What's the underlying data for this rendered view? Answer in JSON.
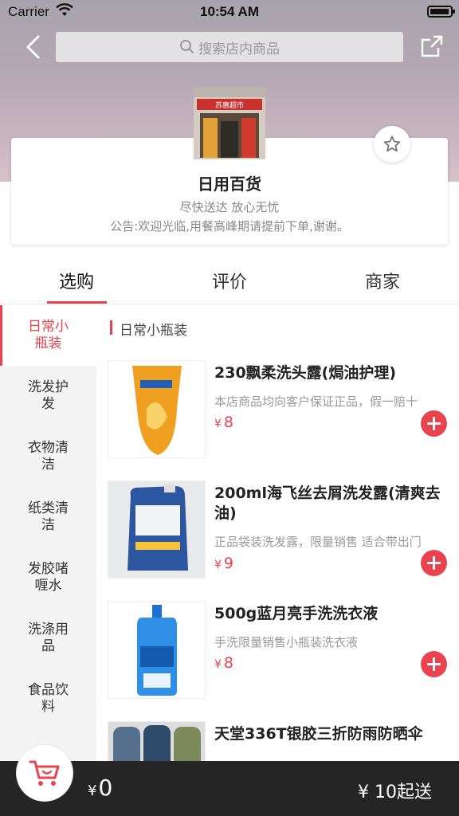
{
  "status_bar": {
    "carrier": "Carrier",
    "time": "10:54 AM"
  },
  "header": {
    "search_placeholder": "搜索店内商品"
  },
  "store": {
    "name": "日用百货",
    "tagline": "尽快送达  放心无忧",
    "notice": "公告:欢迎光临,用餐高峰期请提前下单,谢谢。",
    "logo_sign_text": "苏惠超市"
  },
  "tabs": [
    {
      "label": "选购",
      "active": true
    },
    {
      "label": "评价",
      "active": false
    },
    {
      "label": "商家",
      "active": false
    }
  ],
  "categories": [
    {
      "label": "日常小瓶装",
      "active": true
    },
    {
      "label": "洗发护发",
      "active": false
    },
    {
      "label": "衣物清洁",
      "active": false
    },
    {
      "label": "纸类清洁",
      "active": false
    },
    {
      "label": "发胶啫喱水",
      "active": false
    },
    {
      "label": "洗涤用品",
      "active": false
    },
    {
      "label": "食品饮料",
      "active": false
    }
  ],
  "section_title": "日常小瓶装",
  "products": [
    {
      "title": "230飘柔洗头露(焗油护理)",
      "desc": "本店商品均向客户保证正品，假一赔十",
      "currency": "¥",
      "price": "8"
    },
    {
      "title": "200ml海飞丝去屑洗发露(清爽去油)",
      "desc": "正品袋装洗发露，限量销售 适合带出门",
      "currency": "¥",
      "price": "9"
    },
    {
      "title": "500g蓝月亮手洗洗衣液",
      "desc": "手洗限量销售小瓶装洗衣液",
      "currency": "¥",
      "price": "8"
    },
    {
      "title": "天堂336T银胶三折防雨防晒伞",
      "desc": "",
      "currency": "¥",
      "price": ""
    }
  ],
  "cart": {
    "currency": "¥",
    "total": "0",
    "min_order": "¥ 10起送"
  },
  "colors": {
    "accent": "#e8434f",
    "cart_bar": "#252525",
    "sidebar_bg": "#f4f4f4"
  }
}
